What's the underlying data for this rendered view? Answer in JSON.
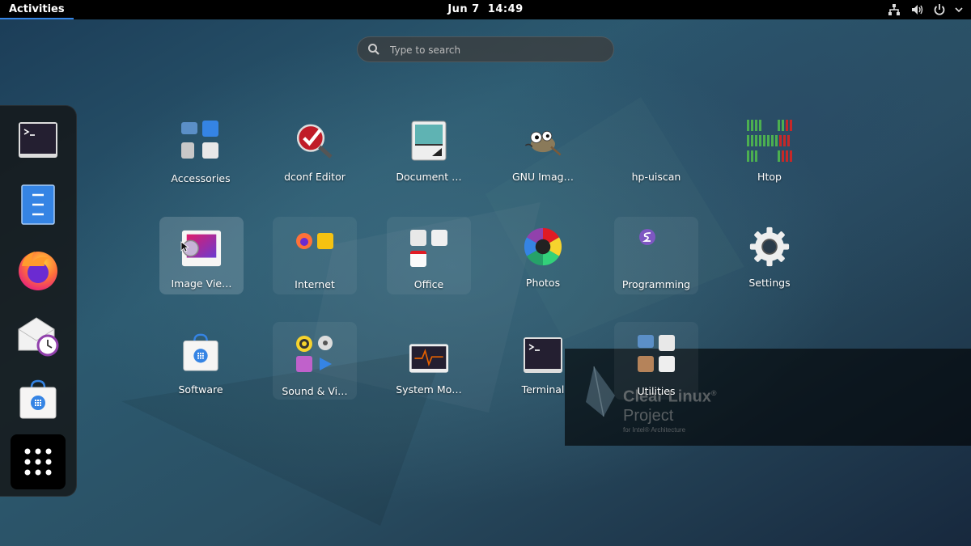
{
  "topbar": {
    "activities_label": "Activities",
    "date": "Jun 7",
    "time": "14:49"
  },
  "search": {
    "placeholder": "Type to search"
  },
  "dash": {
    "items": [
      {
        "name": "terminal",
        "icon": "terminal-icon"
      },
      {
        "name": "files",
        "icon": "file-cabinet-icon"
      },
      {
        "name": "firefox",
        "icon": "firefox-icon"
      },
      {
        "name": "evolution",
        "icon": "mail-clock-icon"
      },
      {
        "name": "software",
        "icon": "software-bag-icon"
      },
      {
        "name": "show-applications",
        "icon": "app-grid-icon"
      }
    ]
  },
  "apps": {
    "accessories": "Accessories",
    "dconf": "dconf Editor",
    "document": "Document …",
    "gimp": "GNU Imag…",
    "hpuiscan": "hp-uiscan",
    "htop": "Htop",
    "imageviewer": "Image Vie…",
    "internet": "Internet",
    "office": "Office",
    "photos": "Photos",
    "programming": "Programming",
    "settings": "Settings",
    "software": "Software",
    "sound": "Sound & Vi…",
    "sysmon": "System Mo…",
    "terminal": "Terminal",
    "utilities": "Utilities"
  },
  "watermark": {
    "line1": "Clear Linux",
    "reg": "®",
    "line2": "Project",
    "line3": "for Intel® Architecture"
  },
  "colors": {
    "accent": "#3584e4",
    "topbar": "#000000"
  }
}
